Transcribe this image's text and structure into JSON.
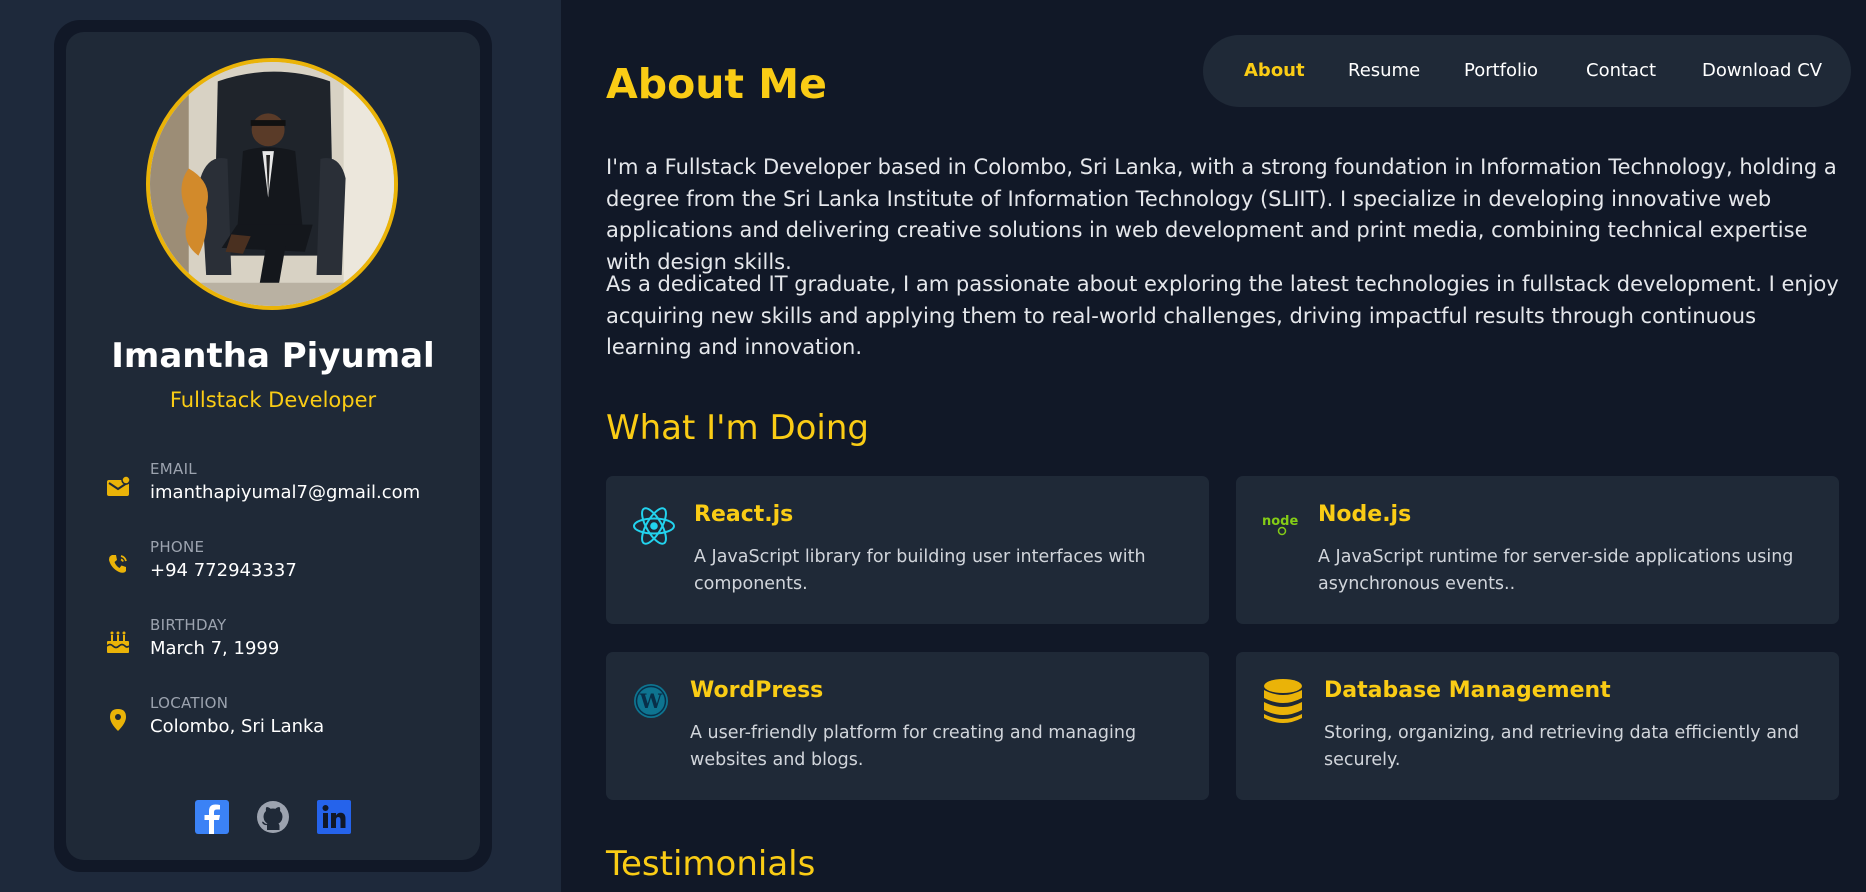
{
  "profile": {
    "name": "Imantha Piyumal",
    "role": "Fullstack Developer",
    "avatar_icon": "profile-photo",
    "accent_color": "#eab308"
  },
  "contacts": [
    {
      "label": "EMAIL",
      "value": "imanthapiyumal7@gmail.com",
      "icon": "email-icon"
    },
    {
      "label": "PHONE",
      "value": "+94 772943337",
      "icon": "phone-icon"
    },
    {
      "label": "BIRTHDAY",
      "value": "March 7, 1999",
      "icon": "birthday-cake-icon"
    },
    {
      "label": "LOCATION",
      "value": "Colombo, Sri Lanka",
      "icon": "location-pin-icon"
    }
  ],
  "social": [
    {
      "icon": "facebook-icon",
      "color": "#3b82f6"
    },
    {
      "icon": "github-icon",
      "color": "#9ca3af"
    },
    {
      "icon": "linkedin-icon",
      "color": "#2563eb"
    }
  ],
  "nav": {
    "items": [
      "About",
      "Resume",
      "Portfolio",
      "Contact",
      "Download CV"
    ],
    "active": "About"
  },
  "about": {
    "title": "About Me",
    "paragraphs": [
      "I'm a Fullstack Developer based in Colombo, Sri Lanka, with a strong foundation in Information Technology, holding a degree from the Sri Lanka Institute of Information Technology (SLIIT). I specialize in developing innovative web applications and delivering creative solutions in web development and print media, combining technical expertise with design skills.",
      "As a dedicated IT graduate, I am passionate about exploring the latest technologies in fullstack development. I enjoy acquiring new skills and applying them to real-world challenges, driving impactful results through continuous learning and innovation."
    ]
  },
  "doing": {
    "title": "What I'm Doing",
    "services": [
      {
        "title": "React.js",
        "desc": "A JavaScript library for building user interfaces with components.",
        "icon": "react-icon"
      },
      {
        "title": "Node.js",
        "desc": "A JavaScript runtime for server-side applications using asynchronous events..",
        "icon": "nodejs-icon"
      },
      {
        "title": "WordPress",
        "desc": "A user-friendly platform for creating and managing websites and blogs.",
        "icon": "wordpress-icon"
      },
      {
        "title": "Database Management",
        "desc": "Storing, organizing, and retrieving data efficiently and securely.",
        "icon": "database-icon"
      }
    ]
  },
  "testimonials": {
    "title": "Testimonials"
  }
}
